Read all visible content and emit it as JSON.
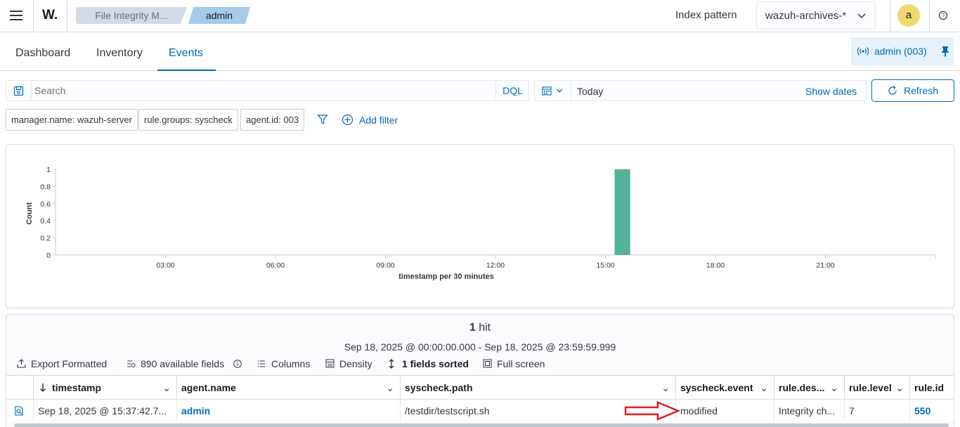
{
  "header": {
    "logo_text": "W.",
    "breadcrumbs": [
      "File Integrity M...",
      "admin"
    ],
    "index_pattern_label": "Index pattern",
    "index_pattern_value": "wazuh-archives-*",
    "avatar_letter": "a"
  },
  "tabs": [
    "Dashboard",
    "Inventory",
    "Events"
  ],
  "active_tab": "Events",
  "agent_pill": "admin (003)",
  "search": {
    "placeholder": "Search",
    "language": "DQL",
    "date_value": "Today",
    "show_dates": "Show dates",
    "refresh": "Refresh"
  },
  "filters": [
    "manager.name: wazuh-server",
    "rule.groups: syscheck",
    "agent.id: 003"
  ],
  "add_filter": "Add filter",
  "colors": {
    "accent": "#006bb8",
    "bar": "#54b399",
    "arrow": "#e01e1e"
  },
  "chart_data": {
    "type": "bar",
    "xlabel": "timestamp per 30 minutes",
    "ylabel": "Count",
    "ylim": [
      0,
      1
    ],
    "y_ticks": [
      "0",
      "0.2",
      "0.4",
      "0.6",
      "0.8",
      "1"
    ],
    "x_ticks": [
      "03:00",
      "06:00",
      "09:00",
      "12:00",
      "15:00",
      "18:00",
      "21:00"
    ],
    "x_range_hours": [
      0,
      24
    ],
    "bars": [
      {
        "x": "15:30",
        "value": 1
      }
    ],
    "grid": false
  },
  "results": {
    "hits_count": "1",
    "hits_label": "hit",
    "range_text": "Sep 18, 2025 @ 00:00:00.000 - Sep 18, 2025 @ 23:59:59.999",
    "toolbar": {
      "export": "Export Formatted",
      "fields": "890 available fields",
      "columns": "Columns",
      "density": "Density",
      "sorted": "1 fields sorted",
      "fullscreen": "Full screen"
    },
    "columns": [
      "timestamp",
      "agent.name",
      "syscheck.path",
      "syscheck.event",
      "rule.des...",
      "rule.level",
      "rule.id"
    ],
    "rows": [
      [
        "Sep 18, 2025 @ 15:37:42.7...",
        "admin",
        "/testdir/testscript.sh",
        "modified",
        "Integrity ch...",
        "7",
        "550"
      ]
    ]
  }
}
